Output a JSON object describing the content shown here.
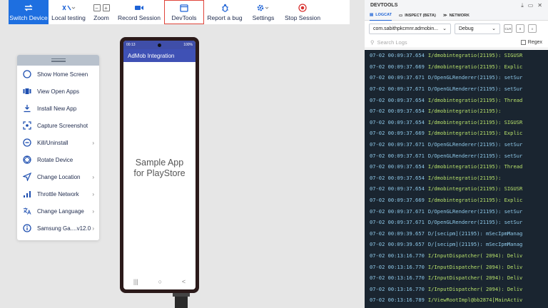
{
  "toolbar": {
    "items": [
      {
        "label": "Switch Device",
        "icon": "switch-arrows-icon"
      },
      {
        "label": "Local testing",
        "icon": "local-testing-icon"
      },
      {
        "label": "Zoom",
        "icon": "zoom-icon"
      },
      {
        "label": "Record Session",
        "icon": "record-video-icon"
      },
      {
        "label": "DevTools",
        "icon": "devtools-window-icon"
      },
      {
        "label": "Report a bug",
        "icon": "bug-icon"
      },
      {
        "label": "Settings",
        "icon": "gear-icon"
      },
      {
        "label": "Stop Session",
        "icon": "stop-icon"
      }
    ],
    "zoom_minus": "−",
    "zoom_plus": "+"
  },
  "menu": {
    "items": [
      {
        "label": "Show Home Screen",
        "icon": "home-circle-icon",
        "has_submenu": false
      },
      {
        "label": "View Open Apps",
        "icon": "open-apps-icon",
        "has_submenu": false
      },
      {
        "label": "Install New App",
        "icon": "install-icon",
        "has_submenu": false
      },
      {
        "label": "Capture Screenshot",
        "icon": "screenshot-icon",
        "has_submenu": false
      },
      {
        "label": "Kill/Uninstall",
        "icon": "kill-icon",
        "has_submenu": true
      },
      {
        "label": "Rotate Device",
        "icon": "rotate-icon",
        "has_submenu": false
      },
      {
        "label": "Change Location",
        "icon": "location-icon",
        "has_submenu": true
      },
      {
        "label": "Throttle Network",
        "icon": "network-bars-icon",
        "has_submenu": true
      },
      {
        "label": "Change Language",
        "icon": "language-icon",
        "has_submenu": true
      },
      {
        "label": "Samsung Ga....v12.0",
        "icon": "info-icon",
        "has_submenu": true
      }
    ]
  },
  "phone": {
    "status_time": "00:13",
    "status_right": "100%",
    "app_title": "AdMob Integration",
    "body_line1": "Sample App",
    "body_line2": "for PlayStore",
    "nav": [
      "|||",
      "○",
      "<"
    ]
  },
  "devtools": {
    "title": "DEVTOOLS",
    "tabs": [
      {
        "label": "LOGCAT",
        "active": true
      },
      {
        "label": "INSPECT (BETA)",
        "active": false
      },
      {
        "label": "NETWORK",
        "active": false
      }
    ],
    "package_select": "com.sabithpkcmnr.admobin...",
    "level_select": "Debug",
    "tiny_buttons": [
      "CLR",
      "II",
      "≡"
    ],
    "search_placeholder": "Search Logs",
    "regex_label": "Regex",
    "logs": [
      {
        "ts": "07-02 00:09:37.654",
        "msg": "I/dmobintegratio(21195): SIGUSR",
        "level": "info"
      },
      {
        "ts": "07-02 00:09:37.669",
        "msg": "I/dmobintegratio(21195): Explic",
        "level": "info"
      },
      {
        "ts": "07-02 00:09:37.671",
        "msg": "D/OpenGLRenderer(21195): setSur",
        "level": "debug"
      },
      {
        "ts": "07-02 00:09:37.671",
        "msg": "D/OpenGLRenderer(21195): setSur",
        "level": "debug"
      },
      {
        "ts": "07-02 00:09:37.654",
        "msg": "I/dmobintegratio(21195): Thread",
        "level": "info"
      },
      {
        "ts": "07-02 00:09:37.654",
        "msg": "I/dmobintegratio(21195):",
        "level": "info"
      },
      {
        "ts": "07-02 00:09:37.654",
        "msg": "I/dmobintegratio(21195): SIGUSR",
        "level": "info"
      },
      {
        "ts": "07-02 00:09:37.669",
        "msg": "I/dmobintegratio(21195): Explic",
        "level": "info"
      },
      {
        "ts": "07-02 00:09:37.671",
        "msg": "D/OpenGLRenderer(21195): setSur",
        "level": "debug"
      },
      {
        "ts": "07-02 00:09:37.671",
        "msg": "D/OpenGLRenderer(21195): setSur",
        "level": "debug"
      },
      {
        "ts": "07-02 00:09:37.654",
        "msg": "I/dmobintegratio(21195): Thread",
        "level": "info"
      },
      {
        "ts": "07-02 00:09:37.654",
        "msg": "I/dmobintegratio(21195):",
        "level": "info"
      },
      {
        "ts": "07-02 00:09:37.654",
        "msg": "I/dmobintegratio(21195): SIGUSR",
        "level": "info"
      },
      {
        "ts": "07-02 00:09:37.669",
        "msg": "I/dmobintegratio(21195): Explic",
        "level": "info"
      },
      {
        "ts": "07-02 00:09:37.671",
        "msg": "D/OpenGLRenderer(21195): setSur",
        "level": "debug"
      },
      {
        "ts": "07-02 00:09:37.671",
        "msg": "D/OpenGLRenderer(21195): setSur",
        "level": "debug"
      },
      {
        "ts": "07-02 00:09:39.657",
        "msg": "D/[secipm](21195): mSecIpmManag",
        "level": "debug"
      },
      {
        "ts": "07-02 00:09:39.657",
        "msg": "D/[secipm](21195): mSecIpmManag",
        "level": "debug"
      },
      {
        "ts": "07-02 00:13:16.770",
        "msg": "I/InputDispatcher( 2094): Deliv",
        "level": "info"
      },
      {
        "ts": "07-02 00:13:16.770",
        "msg": "I/InputDispatcher( 2094): Deliv",
        "level": "info"
      },
      {
        "ts": "07-02 00:13:16.770",
        "msg": "I/InputDispatcher( 2094): Deliv",
        "level": "info"
      },
      {
        "ts": "07-02 00:13:16.770",
        "msg": "I/InputDispatcher( 2094): Deliv",
        "level": "info"
      },
      {
        "ts": "07-02 00:13:16.789",
        "msg": "I/ViewRootImpl@bb2874[MainActiv",
        "level": "info"
      }
    ]
  },
  "colors": {
    "accent": "#1e6fe0",
    "highlight": "#e0443a",
    "log_bg": "#1a2530",
    "log_info": "#b6e06a",
    "log_debug": "#8ec8e8"
  }
}
